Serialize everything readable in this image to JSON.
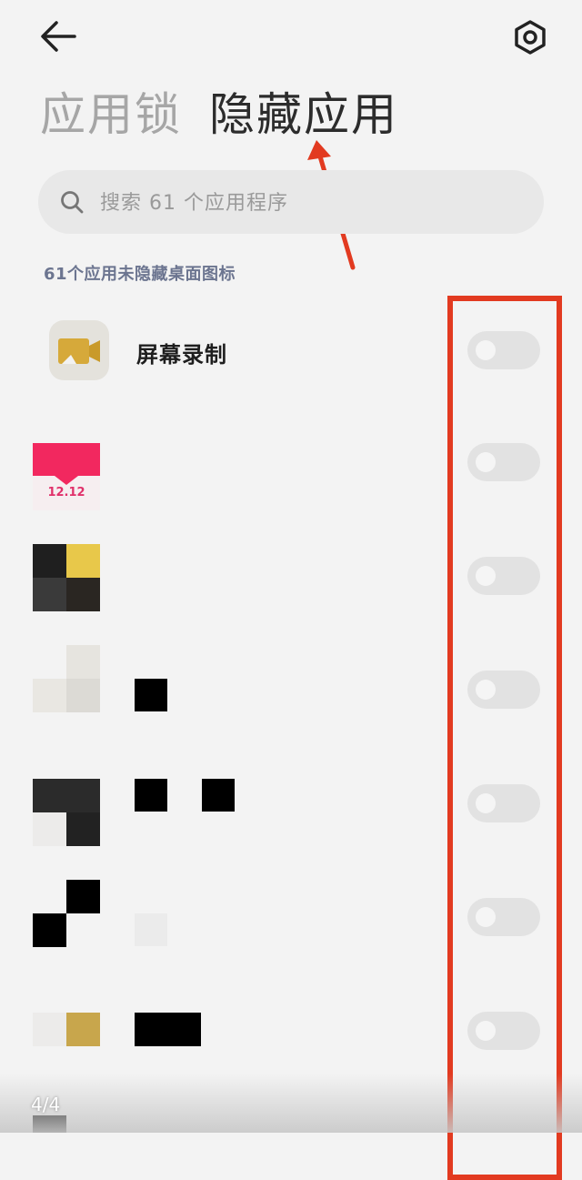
{
  "header": {
    "back_icon": "arrow-left-icon",
    "settings_icon": "gear-hexagon-icon"
  },
  "tabs": [
    {
      "label": "应用锁",
      "active": false
    },
    {
      "label": "隐藏应用",
      "active": true
    }
  ],
  "search": {
    "placeholder": "搜索 61 个应用程序",
    "icon": "search-icon"
  },
  "section": {
    "label": "61个应用未隐藏桌面图标"
  },
  "apps": [
    {
      "name": "屏幕录制",
      "hidden": false
    },
    {
      "name": "",
      "hidden": false
    },
    {
      "name": "",
      "hidden": false
    },
    {
      "name": "",
      "hidden": false
    },
    {
      "name": "",
      "hidden": false
    },
    {
      "name": "",
      "hidden": false
    },
    {
      "name": "",
      "hidden": false
    }
  ],
  "icon_badge_text": "12.12",
  "annotation": {
    "arrow_color": "#e23a20",
    "box_color": "#e23a20"
  },
  "pager": {
    "text": "4/4"
  }
}
